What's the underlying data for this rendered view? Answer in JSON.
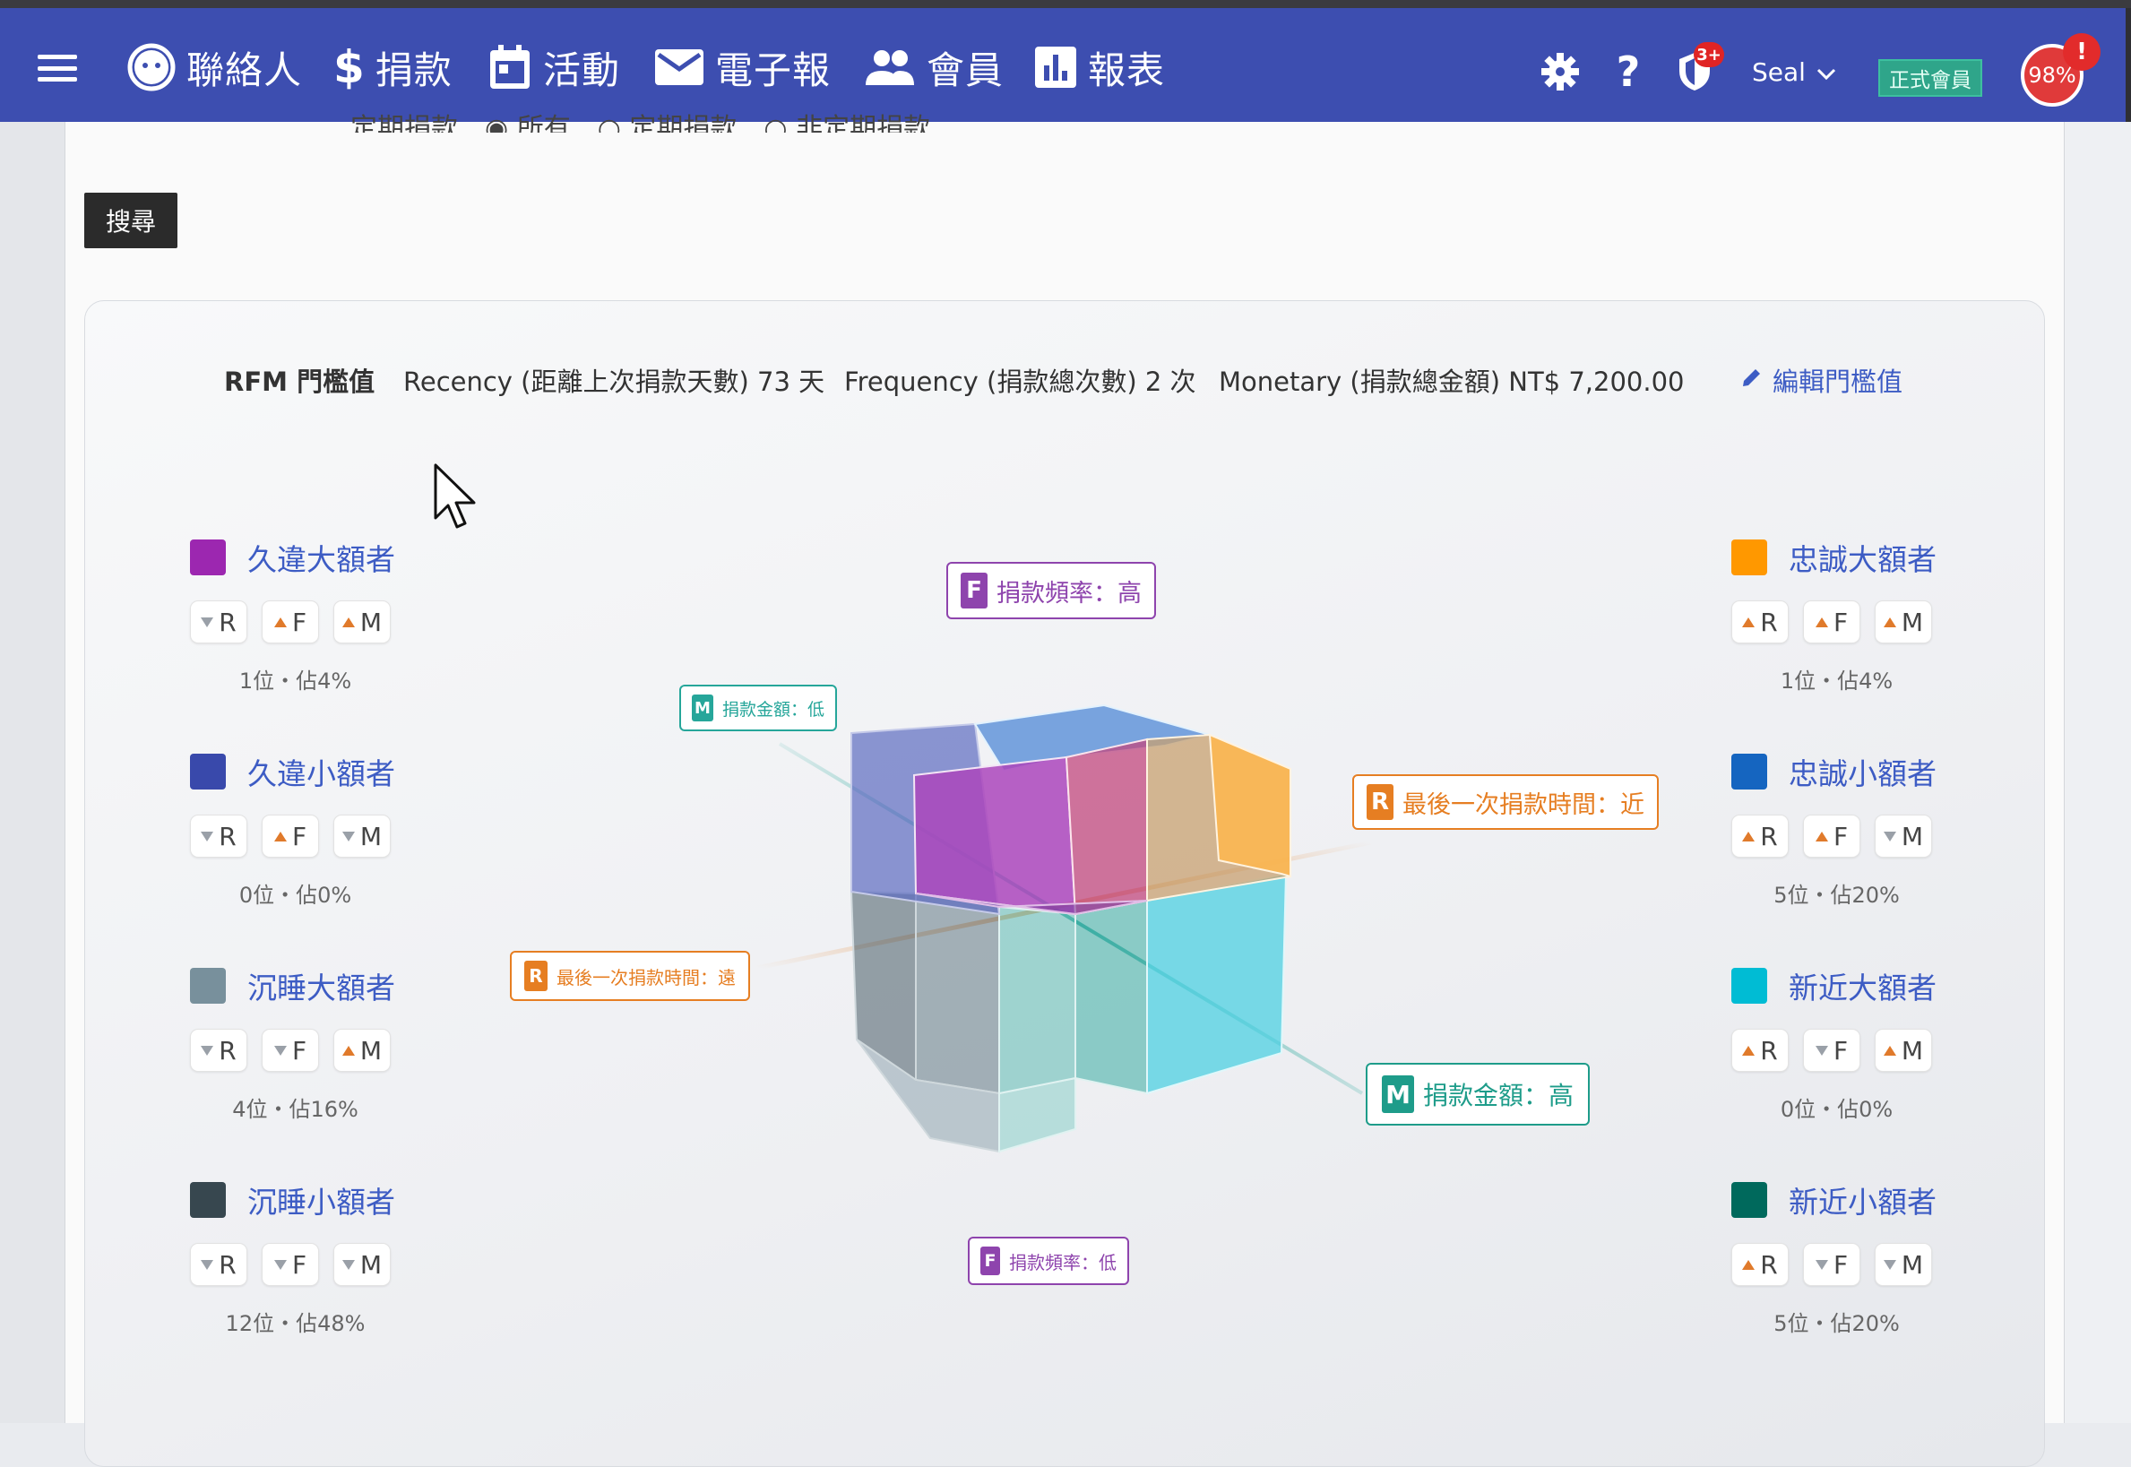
{
  "navbar": {
    "items": [
      {
        "label": "聯絡人",
        "icon": "contact-face-icon"
      },
      {
        "label": "捐款",
        "icon": "dollar-icon"
      },
      {
        "label": "活動",
        "icon": "calendar-icon"
      },
      {
        "label": "電子報",
        "icon": "mail-icon"
      },
      {
        "label": "會員",
        "icon": "people-icon"
      },
      {
        "label": "報表",
        "icon": "bar-chart-icon"
      }
    ],
    "notification_badge": "3+",
    "user_name": "Seal",
    "member_tag": "正式會員",
    "progress": "98%",
    "alert": "!"
  },
  "filter": {
    "partial_text": "定期捐款　◉ 所有　○ 定期捐款　○ 非定期捐款"
  },
  "search_button": "搜尋",
  "rfm": {
    "title": "RFM 門檻值",
    "recency": "Recency (距離上次捐款天數) 73 天",
    "frequency": "Frequency (捐款總次數) 2 次",
    "monetary": "Monetary (捐款總金額) NT$ 7,200.00",
    "edit": "編輯門檻值"
  },
  "segments": [
    {
      "name": "久違大額者",
      "color": "#9c27b0",
      "r": "down",
      "f": "up",
      "m": "up",
      "stat": "1位・佔4%"
    },
    {
      "name": "久違小額者",
      "color": "#3949ab",
      "r": "down",
      "f": "up",
      "m": "down",
      "stat": "0位・佔0%"
    },
    {
      "name": "沉睡大額者",
      "color": "#78909c",
      "r": "down",
      "f": "down",
      "m": "up",
      "stat": "4位・佔16%"
    },
    {
      "name": "沉睡小額者",
      "color": "#37474f",
      "r": "down",
      "f": "down",
      "m": "down",
      "stat": "12位・佔48%"
    },
    {
      "name": "忠誠大額者",
      "color": "#ff9800",
      "r": "up",
      "f": "up",
      "m": "up",
      "stat": "1位・佔4%"
    },
    {
      "name": "忠誠小額者",
      "color": "#1565c0",
      "r": "up",
      "f": "up",
      "m": "down",
      "stat": "5位・佔20%"
    },
    {
      "name": "新近大額者",
      "color": "#00bcd4",
      "r": "up",
      "f": "down",
      "m": "up",
      "stat": "0位・佔0%"
    },
    {
      "name": "新近小額者",
      "color": "#00695c",
      "r": "up",
      "f": "down",
      "m": "down",
      "stat": "5位・佔20%"
    }
  ],
  "chip_letters": [
    "R",
    "F",
    "M"
  ],
  "axes": {
    "f_high": {
      "key": "F",
      "text": "捐款頻率：高",
      "color": "#8e44ad"
    },
    "f_low": {
      "key": "F",
      "text": "捐款頻率：低",
      "color": "#8e44ad"
    },
    "m_low": {
      "key": "M",
      "text": "捐款金額：低",
      "color": "#26a69a"
    },
    "m_high": {
      "key": "M",
      "text": "捐款金額：高",
      "color": "#1e9c8a"
    },
    "r_near": {
      "key": "R",
      "text": "最後一次捐款時間：近",
      "color": "#e67e22"
    },
    "r_far": {
      "key": "R",
      "text": "最後一次捐款時間：遠",
      "color": "#e67e22"
    }
  }
}
